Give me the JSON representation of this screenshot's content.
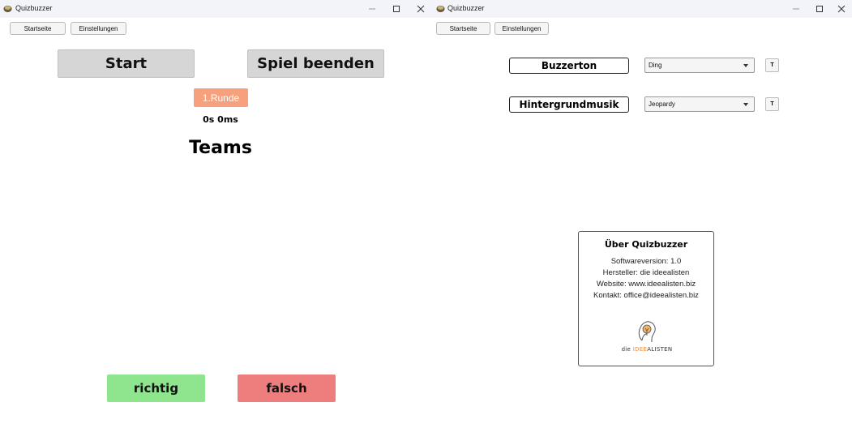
{
  "left_window": {
    "title": "Quizbuzzer",
    "menu": {
      "home": "Startseite",
      "settings": "Einstellungen"
    },
    "start_label": "Start",
    "end_game_label": "Spiel beenden",
    "round_label": "1.Runde",
    "timer": "0s 0ms",
    "teams_heading": "Teams",
    "correct_label": "richtig",
    "wrong_label": "falsch"
  },
  "right_window": {
    "title": "Quizbuzzer",
    "menu": {
      "home": "Startseite",
      "settings": "Einstellungen"
    },
    "settings": [
      {
        "label": "Buzzerton",
        "selected": "Ding",
        "test_label": "T"
      },
      {
        "label": "Hintergrundmusik",
        "selected": "Jeopardy",
        "test_label": "T"
      }
    ],
    "about": {
      "title": "Über Quizbuzzer",
      "lines": [
        "Softwareversion: 1.0",
        "Hersteller: die ideealisten",
        "Website: www.ideealisten.biz",
        "Kontakt: office@ideealisten.biz"
      ],
      "logo_text_prefix": "die ",
      "logo_text_highlight": "IDEE",
      "logo_text_suffix": "ALISTEN"
    }
  },
  "colors": {
    "round_badge": "#f7a07d",
    "correct": "#8ee58e",
    "wrong": "#ee7e7e",
    "button_gray": "#d6d6d6",
    "titlebar": "#f3f4f9"
  },
  "icons": [
    "app-icon",
    "minimize-icon",
    "maximize-icon",
    "close-icon",
    "dropdown-caret-icon",
    "idealisten-logo"
  ]
}
